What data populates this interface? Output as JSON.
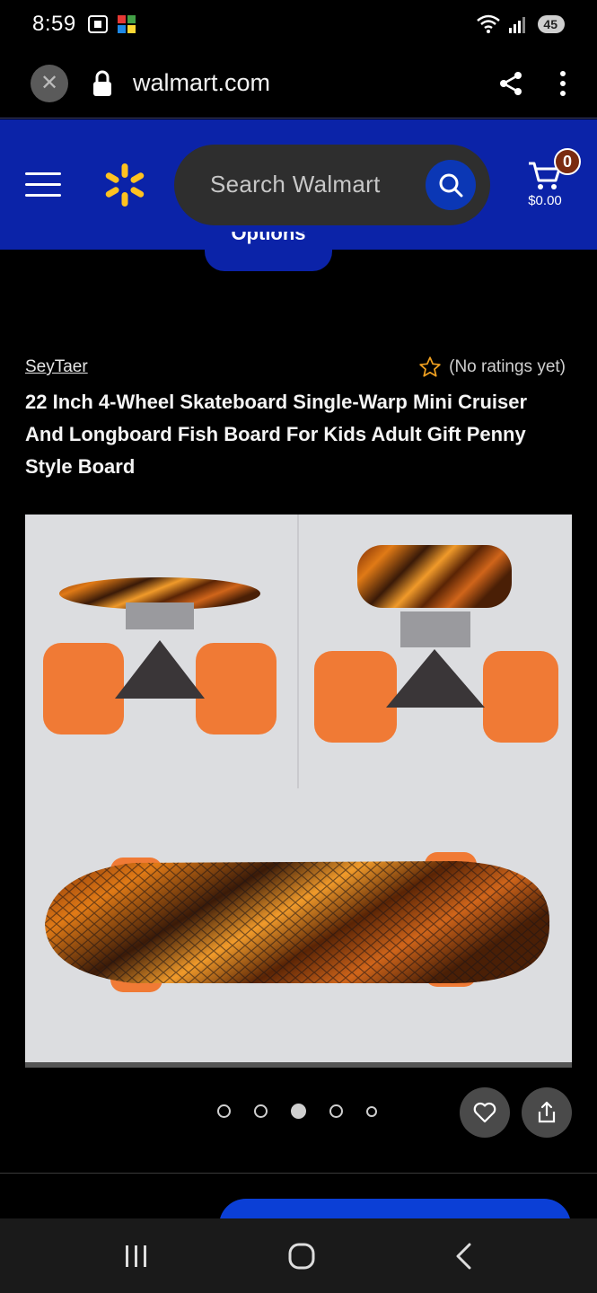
{
  "status_bar": {
    "time": "8:59",
    "battery": "45"
  },
  "browser": {
    "url": "walmart.com"
  },
  "header": {
    "search_placeholder": "Search Walmart",
    "cart_count": "0",
    "cart_total": "$0.00"
  },
  "options_pill": {
    "label": "Options"
  },
  "product": {
    "brand": "SeyTaer",
    "rating_text": "(No ratings yet)",
    "title": "22 Inch 4-Wheel Skateboard Single-Warp Mini Cruiser And Longboard Fish Board For Kids Adult Gift Penny Style Board"
  },
  "carousel": {
    "total_dots": 5,
    "active_index": 2
  },
  "colors": {
    "walmart_blue": "#0b23a8",
    "spark_yellow": "#ffc220",
    "wheel_orange": "#f07a35"
  },
  "icons": [
    "close-icon",
    "lock-icon",
    "share-icon",
    "more-vert-icon",
    "menu-icon",
    "walmart-spark-icon",
    "search-icon",
    "cart-icon",
    "star-icon",
    "heart-icon",
    "share-box-icon",
    "recent-apps-icon",
    "home-icon",
    "back-icon"
  ]
}
